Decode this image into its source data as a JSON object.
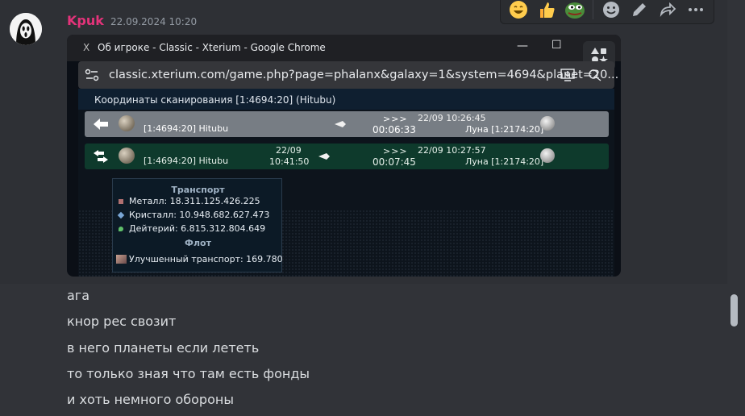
{
  "message": {
    "author": "Kpuk",
    "timestamp": "22.09.2024 10:20",
    "lines": [
      "ага",
      "кнор рес свозит",
      "в него планеты если лететь",
      "то только зная что там есть фонды",
      "и хоть немного обороны"
    ]
  },
  "toolbar": {
    "icons": [
      "grinning-emoji",
      "thumbs-up-emoji",
      "pepe-emoji",
      "add-reaction-icon",
      "edit-icon",
      "reply-icon",
      "more-icon"
    ]
  },
  "screenshot": {
    "window_title": "Об игроке - Classic - Xterium - Google Chrome",
    "url": "classic.xterium.com/game.php?page=phalanx&galaxy=1&system=4694&planet=20...",
    "scan_title": "Координаты сканирования [1:4694:20] (Hitubu)",
    "rows": [
      {
        "origin": "[1:4694:20] Hitubu",
        "start_date": "",
        "start_time": "",
        "arrows": ">>>",
        "duration": "00:06:33",
        "arrival": "22/09 10:26:45",
        "target": "Луна [1:2174:20]"
      },
      {
        "origin": "[1:4694:20] Hitubu",
        "start_date": "22/09",
        "start_time": "10:41:50",
        "arrows": ">>>",
        "duration": "00:07:45",
        "arrival": "22/09 10:27:57",
        "target": "Луна [1:2174:20]"
      }
    ],
    "tooltip": {
      "cargo_title": "Транспорт",
      "metal": "Металл: 18.311.125.426.225",
      "crystal": "Кристалл: 10.948.682.627.473",
      "deuterium": "Дейтерий: 6.815.312.804.649",
      "fleet_title": "Флот",
      "ship": "Улучшенный транспорт: 169.780"
    }
  },
  "colors": {
    "author": "#e4337a",
    "row_return": "#777d84",
    "row_outgoing": "#0e3a2c",
    "background": "#313338"
  }
}
